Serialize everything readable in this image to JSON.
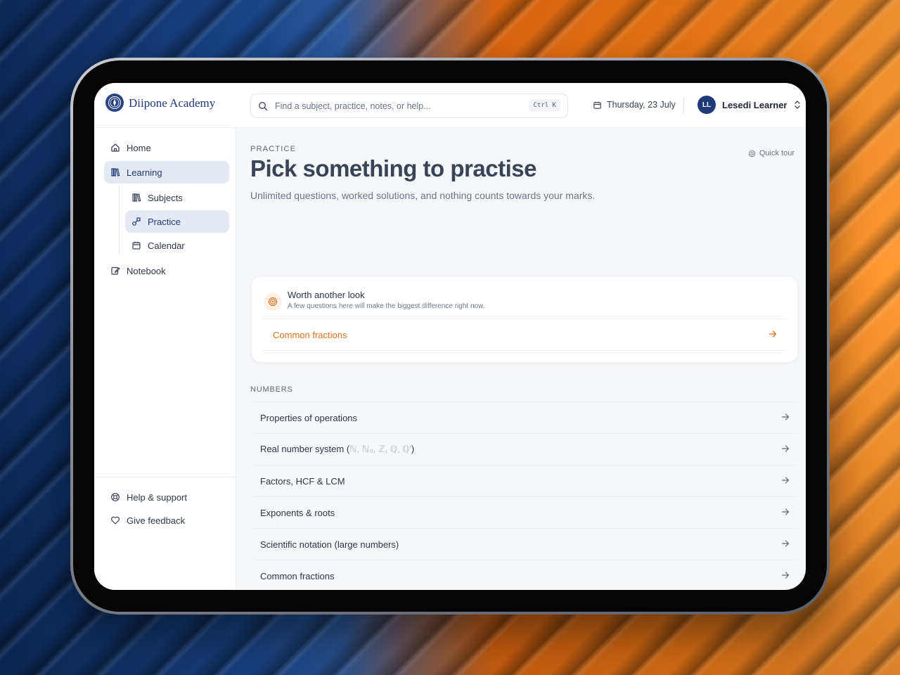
{
  "brand": {
    "name": "Diipone Academy"
  },
  "search": {
    "placeholder": "Find a subject, practice, notes, or help...",
    "shortcut": "Ctrl K"
  },
  "header": {
    "date": "Thursday, 23 July",
    "user_initials": "LL",
    "user_name": "Lesedi Learner"
  },
  "sidebar": {
    "items": [
      {
        "label": "Home",
        "icon": "home-icon"
      },
      {
        "label": "Learning",
        "icon": "books-icon",
        "active": true
      },
      {
        "label": "Subjects",
        "icon": "books-icon"
      },
      {
        "label": "Practice",
        "icon": "shapes-icon",
        "active": true
      },
      {
        "label": "Calendar",
        "icon": "calendar-icon"
      },
      {
        "label": "Notebook",
        "icon": "notebook-icon"
      }
    ],
    "footer": [
      {
        "label": "Help & support",
        "icon": "lifebuoy-icon"
      },
      {
        "label": "Give feedback",
        "icon": "heart-icon"
      }
    ]
  },
  "page": {
    "eyebrow": "PRACTICE",
    "title": "Pick something to practise",
    "subtitle": "Unlimited questions, worked solutions, and nothing counts towards your marks.",
    "quick_tour": "Quick tour"
  },
  "worth_card": {
    "title": "Worth another look",
    "description": "A few questions here will make the biggest difference right now.",
    "link": "Common fractions"
  },
  "section": {
    "label": "NUMBERS",
    "items": [
      {
        "label": "Properties of operations"
      },
      {
        "label": "Real number system (",
        "faint": "ℕ, ℕ₀, ℤ, ℚ, ℚ'",
        "suffix": ")"
      },
      {
        "label": "Factors, HCF & LCM"
      },
      {
        "label": "Exponents & roots"
      },
      {
        "label": "Scientific notation (large numbers)"
      },
      {
        "label": "Common fractions"
      }
    ]
  },
  "colors": {
    "accent": "#1f3a78",
    "highlight": "#d9731f",
    "active_bg": "#e4e9f4"
  }
}
